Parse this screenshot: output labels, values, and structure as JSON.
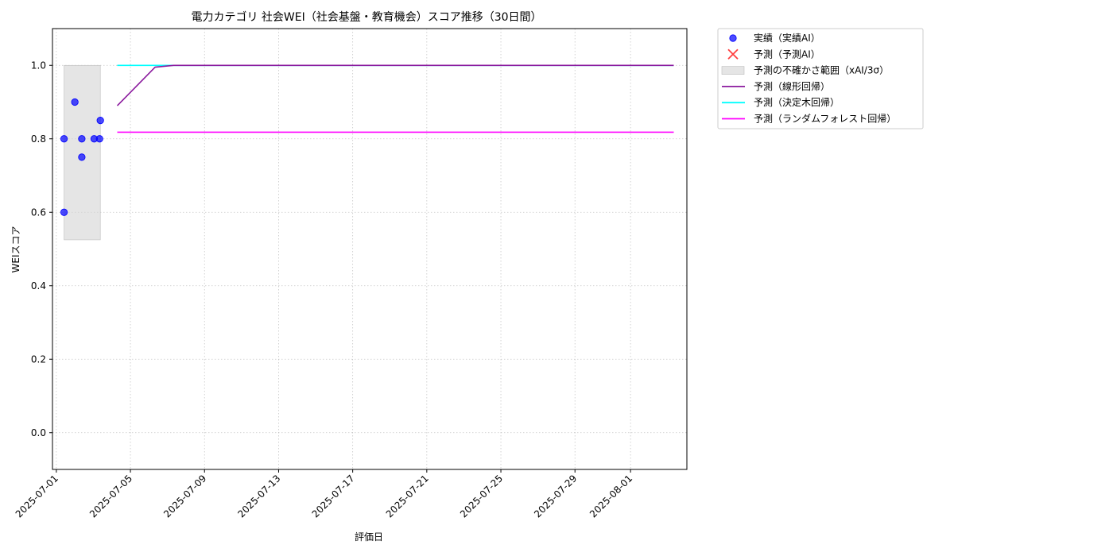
{
  "chart_data": {
    "type": "line",
    "title": "電力カテゴリ 社会WEI（社会基盤・教育機会）スコア推移（30日間）",
    "xlabel": "評価日",
    "ylabel": "WEIスコア",
    "xlim": [
      "2025-06-30T19:00",
      "2025-08-04T01:00"
    ],
    "ylim": [
      -0.1,
      1.1
    ],
    "xticks": [
      "2025-07-01",
      "2025-07-05",
      "2025-07-09",
      "2025-07-13",
      "2025-07-17",
      "2025-07-21",
      "2025-07-25",
      "2025-07-29",
      "2025-08-01"
    ],
    "yticks": [
      0.0,
      0.2,
      0.4,
      0.6,
      0.8,
      1.0
    ],
    "ytick_labels": [
      "0.0",
      "0.2",
      "0.4",
      "0.6",
      "0.8",
      "1.0"
    ],
    "grid": true,
    "legend_position": "outside-top-right",
    "legend": [
      {
        "label": "実績（実績AI）",
        "kind": "scatter",
        "color": "#0000ff",
        "marker": "circle"
      },
      {
        "label": "予測（予測AI）",
        "kind": "scatter",
        "color": "#ff0000",
        "marker": "x"
      },
      {
        "label": "予測の不確かさ範囲（xAI/3σ）",
        "kind": "band",
        "color": "#d3d3d3"
      },
      {
        "label": "予測（線形回帰）",
        "kind": "line",
        "color": "#8b1a9e"
      },
      {
        "label": "予測（決定木回帰）",
        "kind": "line",
        "color": "#00ffff"
      },
      {
        "label": "予測（ランダムフォレスト回帰）",
        "kind": "line",
        "color": "#ff00ff"
      }
    ],
    "actual": {
      "name": "実績（実績AI）",
      "color": "#0000ff",
      "points": [
        {
          "x": "2025-07-01T10:00",
          "y": 0.8
        },
        {
          "x": "2025-07-01T10:00",
          "y": 0.6
        },
        {
          "x": "2025-07-02T00:00",
          "y": 0.9
        },
        {
          "x": "2025-07-02T09:00",
          "y": 0.8
        },
        {
          "x": "2025-07-02T09:00",
          "y": 0.75
        },
        {
          "x": "2025-07-03T01:00",
          "y": 0.8
        },
        {
          "x": "2025-07-03T08:00",
          "y": 0.8
        },
        {
          "x": "2025-07-03T09:00",
          "y": 0.85
        }
      ]
    },
    "uncertainty_band": {
      "name": "予測の不確かさ範囲（xAI/3σ）",
      "color": "#d3d3d3",
      "x": [
        "2025-07-01T10:00",
        "2025-07-03T09:00"
      ],
      "lower": 0.525,
      "upper": 1.0
    },
    "series": [
      {
        "name": "予測（線形回帰）",
        "color": "#8b1a9e",
        "points": [
          {
            "x": "2025-07-04T07:00",
            "y": 0.89
          },
          {
            "x": "2025-07-06T08:00",
            "y": 0.995
          },
          {
            "x": "2025-07-07T08:00",
            "y": 1.0
          },
          {
            "x": "2025-08-03T08:00",
            "y": 1.0
          }
        ]
      },
      {
        "name": "予測（決定木回帰）",
        "color": "#00ffff",
        "points": [
          {
            "x": "2025-07-04T07:00",
            "y": 1.0
          },
          {
            "x": "2025-08-03T08:00",
            "y": 1.0
          }
        ]
      },
      {
        "name": "予測（ランダムフォレスト回帰）",
        "color": "#ff00ff",
        "points": [
          {
            "x": "2025-07-04T07:00",
            "y": 0.818
          },
          {
            "x": "2025-08-03T08:00",
            "y": 0.818
          }
        ]
      }
    ]
  }
}
